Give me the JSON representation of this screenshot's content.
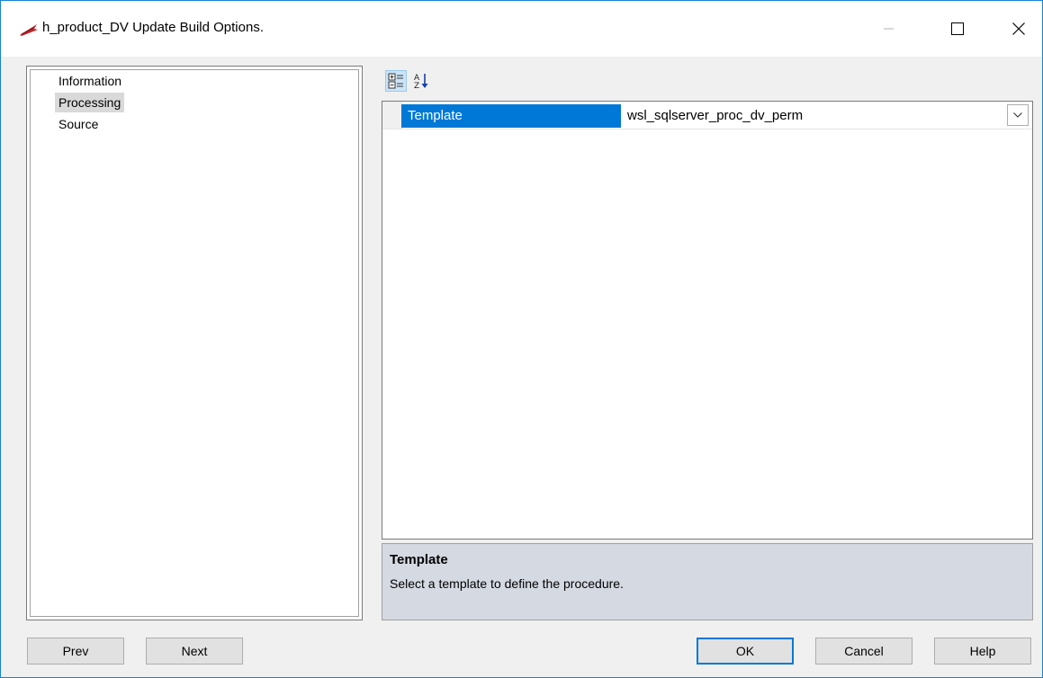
{
  "window": {
    "title": "h_product_DV Update Build Options."
  },
  "tree": {
    "items": [
      {
        "label": "Information",
        "selected": false
      },
      {
        "label": "Processing",
        "selected": true
      },
      {
        "label": "Source",
        "selected": false
      }
    ]
  },
  "toolbar": {
    "categorized_icon": "categorized-view-icon",
    "alphabetical_icon": "sort-alphabetical-icon"
  },
  "property_grid": {
    "rows": [
      {
        "name": "Template",
        "value": "wsl_sqlserver_proc_dv_perm"
      }
    ]
  },
  "description": {
    "title": "Template",
    "text": "Select a template to define the procedure."
  },
  "buttons": {
    "prev": "Prev",
    "next": "Next",
    "ok": "OK",
    "cancel": "Cancel",
    "help": "Help"
  },
  "colors": {
    "accent": "#0078d7",
    "window_border": "#1883d7",
    "description_bg": "#d4d9e2",
    "selected_tree_bg": "#d9d9d9"
  }
}
